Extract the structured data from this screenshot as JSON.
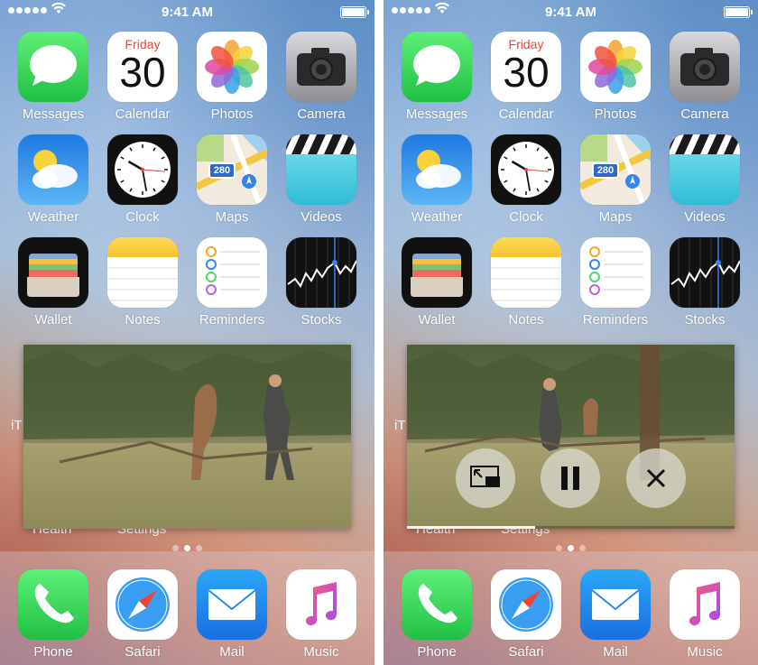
{
  "status_bar": {
    "time": "9:41 AM"
  },
  "calendar": {
    "weekday": "Friday",
    "day": "30"
  },
  "apps": [
    {
      "label": "Messages",
      "icon": "messages-icon",
      "color": "#38d25a"
    },
    {
      "label": "Calendar",
      "icon": "calendar-icon",
      "color": "#ffffff"
    },
    {
      "label": "Photos",
      "icon": "photos-icon",
      "color": "#ffffff"
    },
    {
      "label": "Camera",
      "icon": "camera-icon",
      "color": "#8e8e93"
    },
    {
      "label": "Weather",
      "icon": "weather-icon",
      "color": "#3a8ee6"
    },
    {
      "label": "Clock",
      "icon": "clock-icon",
      "color": "#111111"
    },
    {
      "label": "Maps",
      "icon": "maps-icon",
      "color": "#f2eadc"
    },
    {
      "label": "Videos",
      "icon": "videos-icon",
      "color": "#4ad5e4"
    },
    {
      "label": "Wallet",
      "icon": "wallet-icon",
      "color": "#111111"
    },
    {
      "label": "Notes",
      "icon": "notes-icon",
      "color": "#ffffff"
    },
    {
      "label": "Reminders",
      "icon": "reminders-icon",
      "color": "#ffffff"
    },
    {
      "label": "Stocks",
      "icon": "stocks-icon",
      "color": "#111111"
    }
  ],
  "maps_badge": "280",
  "partial_labels": {
    "itunes": "iT",
    "health": "Health",
    "settings": "Settings"
  },
  "dock": [
    {
      "label": "Phone",
      "icon": "phone-icon",
      "color": "#38d25a"
    },
    {
      "label": "Safari",
      "icon": "safari-icon",
      "color": "#ffffff"
    },
    {
      "label": "Mail",
      "icon": "mail-icon",
      "color": "#2f8bf0"
    },
    {
      "label": "Music",
      "icon": "music-icon",
      "color": "#ffffff"
    }
  ],
  "pages": {
    "count": 3,
    "current": 2
  },
  "pip": {
    "left_state": "playing",
    "right_state": "controls-visible",
    "progress": 0.39,
    "controls": [
      {
        "name": "pip-restore-button",
        "icon": "picture-in-picture-restore-icon"
      },
      {
        "name": "pause-button",
        "icon": "pause-icon"
      },
      {
        "name": "close-button",
        "icon": "close-icon"
      }
    ]
  }
}
